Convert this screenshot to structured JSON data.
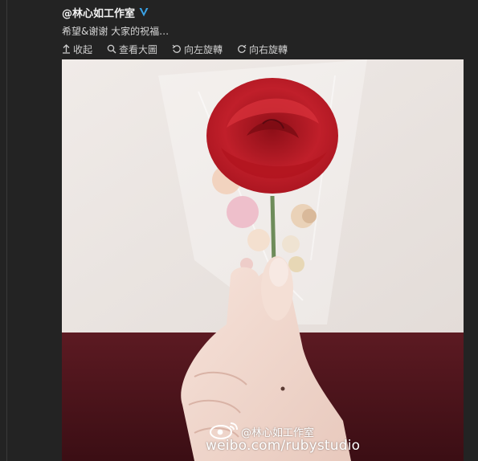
{
  "post": {
    "author": "@林心如工作室",
    "caption": "希望&谢谢 大家的祝福…"
  },
  "toolbar": {
    "collapse_label": "收起",
    "view_large_label": "查看大圖",
    "rotate_left_label": "向左旋轉",
    "rotate_right_label": "向右旋轉"
  },
  "photo": {
    "watermark_handle": "@林心如工作室",
    "watermark_url": "weibo.com/rubystudio"
  },
  "icons": {
    "verified": "verified-badge-icon",
    "collapse": "arrow-up-icon",
    "view_large": "magnifier-icon",
    "rotate_left": "rotate-left-icon",
    "rotate_right": "rotate-right-icon",
    "watermark": "weibo-eye-logo-icon"
  },
  "colors": {
    "background": "#232323",
    "verified": "#3aa2e6",
    "rose": "#c01f2a"
  }
}
